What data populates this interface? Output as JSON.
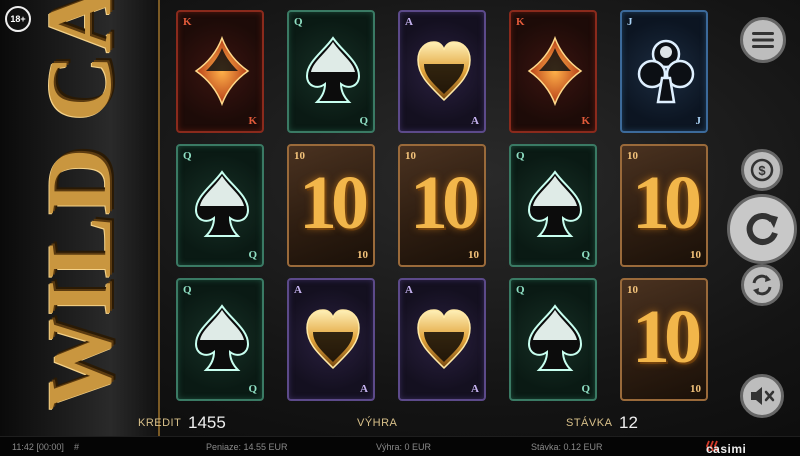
{
  "age_badge": "18+",
  "logo": {
    "title": "WILD CARD"
  },
  "reels": [
    [
      {
        "rank": "K",
        "suit": "diamond",
        "theme": "red"
      },
      {
        "rank": "Q",
        "suit": "spade",
        "theme": "green"
      },
      {
        "rank": "Q",
        "suit": "spade",
        "theme": "green"
      }
    ],
    [
      {
        "rank": "Q",
        "suit": "spade",
        "theme": "green"
      },
      {
        "rank": "10",
        "suit": "ten",
        "theme": "gold"
      },
      {
        "rank": "A",
        "suit": "heart",
        "theme": "purple"
      }
    ],
    [
      {
        "rank": "A",
        "suit": "heart",
        "theme": "purple"
      },
      {
        "rank": "10",
        "suit": "ten",
        "theme": "gold"
      },
      {
        "rank": "A",
        "suit": "heart",
        "theme": "purple"
      }
    ],
    [
      {
        "rank": "K",
        "suit": "diamond",
        "theme": "red"
      },
      {
        "rank": "Q",
        "suit": "spade",
        "theme": "green"
      },
      {
        "rank": "Q",
        "suit": "spade",
        "theme": "green"
      }
    ],
    [
      {
        "rank": "J",
        "suit": "club",
        "theme": "blue"
      },
      {
        "rank": "10",
        "suit": "ten",
        "theme": "gold"
      },
      {
        "rank": "10",
        "suit": "ten",
        "theme": "gold"
      }
    ]
  ],
  "controls": {
    "menu_icon": "hamburger-menu-icon",
    "coin_icon": "dollar-coin-icon",
    "spin_icon": "spin-arrow-icon",
    "autoplay_icon": "autoplay-arrows-icon",
    "sound_icon": "speaker-muted-icon"
  },
  "info": {
    "credit_label": "KREDIT",
    "credit_value": "1455",
    "win_label": "VÝHRA",
    "win_value": "",
    "bet_label": "STÁVKA",
    "bet_value": "12"
  },
  "status": {
    "time": "11:42 [00:00]",
    "hash": "#",
    "money": "Peniaze: 14.55 EUR",
    "win": "Výhra: 0 EUR",
    "bet": "Stávka: 0.12 EUR",
    "brand": "casimi"
  },
  "colors": {
    "gold": "#c9963f",
    "button_bg": "#bdbdbd",
    "label": "#d8c08a"
  }
}
